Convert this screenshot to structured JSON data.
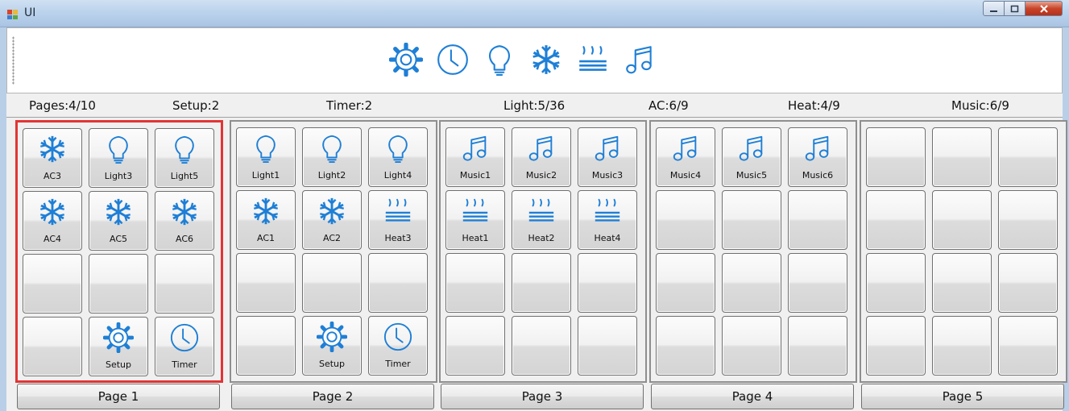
{
  "window": {
    "title": "UI"
  },
  "colors": {
    "icon": "#1e7fd6",
    "selected_border": "#e23434"
  },
  "toolbar": {
    "icons": [
      "gear-icon",
      "clock-icon",
      "bulb-icon",
      "snowflake-icon",
      "heat-icon",
      "music-icon"
    ]
  },
  "status": {
    "pages": "Pages:4/10",
    "setup": "Setup:2",
    "timer": "Timer:2",
    "light": "Light:5/36",
    "ac": "AC:6/9",
    "heat": "Heat:4/9",
    "music": "Music:6/9"
  },
  "pages": [
    {
      "label": "Page 1",
      "selected": true,
      "cells": [
        {
          "icon": "snowflake",
          "label": "AC3"
        },
        {
          "icon": "bulb",
          "label": "Light3"
        },
        {
          "icon": "bulb",
          "label": "Light5"
        },
        {
          "icon": "snowflake",
          "label": "AC4"
        },
        {
          "icon": "snowflake",
          "label": "AC5"
        },
        {
          "icon": "snowflake",
          "label": "AC6"
        },
        {
          "icon": "",
          "label": ""
        },
        {
          "icon": "",
          "label": ""
        },
        {
          "icon": "",
          "label": ""
        },
        {
          "icon": "",
          "label": ""
        },
        {
          "icon": "gear",
          "label": "Setup"
        },
        {
          "icon": "clock",
          "label": "Timer"
        }
      ]
    },
    {
      "label": "Page 2",
      "selected": false,
      "cells": [
        {
          "icon": "bulb",
          "label": "Light1"
        },
        {
          "icon": "bulb",
          "label": "Light2"
        },
        {
          "icon": "bulb",
          "label": "Light4"
        },
        {
          "icon": "snowflake",
          "label": "AC1"
        },
        {
          "icon": "snowflake",
          "label": "AC2"
        },
        {
          "icon": "heat",
          "label": "Heat3"
        },
        {
          "icon": "",
          "label": ""
        },
        {
          "icon": "",
          "label": ""
        },
        {
          "icon": "",
          "label": ""
        },
        {
          "icon": "",
          "label": ""
        },
        {
          "icon": "gear",
          "label": "Setup"
        },
        {
          "icon": "clock",
          "label": "Timer"
        }
      ]
    },
    {
      "label": "Page 3",
      "selected": false,
      "cells": [
        {
          "icon": "music",
          "label": "Music1"
        },
        {
          "icon": "music",
          "label": "Music2"
        },
        {
          "icon": "music",
          "label": "Music3"
        },
        {
          "icon": "heat",
          "label": "Heat1"
        },
        {
          "icon": "heat",
          "label": "Heat2"
        },
        {
          "icon": "heat",
          "label": "Heat4"
        },
        {
          "icon": "",
          "label": ""
        },
        {
          "icon": "",
          "label": ""
        },
        {
          "icon": "",
          "label": ""
        },
        {
          "icon": "",
          "label": ""
        },
        {
          "icon": "",
          "label": ""
        },
        {
          "icon": "",
          "label": ""
        }
      ]
    },
    {
      "label": "Page 4",
      "selected": false,
      "cells": [
        {
          "icon": "music",
          "label": "Music4"
        },
        {
          "icon": "music",
          "label": "Music5"
        },
        {
          "icon": "music",
          "label": "Music6"
        },
        {
          "icon": "",
          "label": ""
        },
        {
          "icon": "",
          "label": ""
        },
        {
          "icon": "",
          "label": ""
        },
        {
          "icon": "",
          "label": ""
        },
        {
          "icon": "",
          "label": ""
        },
        {
          "icon": "",
          "label": ""
        },
        {
          "icon": "",
          "label": ""
        },
        {
          "icon": "",
          "label": ""
        },
        {
          "icon": "",
          "label": ""
        }
      ]
    },
    {
      "label": "Page 5",
      "selected": false,
      "cells": [
        {
          "icon": "",
          "label": ""
        },
        {
          "icon": "",
          "label": ""
        },
        {
          "icon": "",
          "label": ""
        },
        {
          "icon": "",
          "label": ""
        },
        {
          "icon": "",
          "label": ""
        },
        {
          "icon": "",
          "label": ""
        },
        {
          "icon": "",
          "label": ""
        },
        {
          "icon": "",
          "label": ""
        },
        {
          "icon": "",
          "label": ""
        },
        {
          "icon": "",
          "label": ""
        },
        {
          "icon": "",
          "label": ""
        },
        {
          "icon": "",
          "label": ""
        }
      ]
    }
  ]
}
